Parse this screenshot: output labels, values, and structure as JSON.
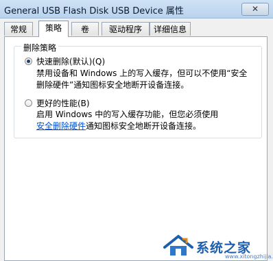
{
  "window": {
    "title": "General USB Flash Disk USB Device 属性",
    "close_glyph": "✕"
  },
  "tabs": [
    {
      "label": "常规"
    },
    {
      "label": "策略"
    },
    {
      "label": "卷"
    },
    {
      "label": "驱动程序"
    },
    {
      "label": "详细信息"
    }
  ],
  "active_tab": "策略",
  "removal_policy": {
    "group_title": "删除策略",
    "options": [
      {
        "label": "快速删除(默认)(Q)",
        "selected": true,
        "description_lines": [
          "禁用设备和 Windows 上的写入缓存，但可以不使用“安全",
          "删除硬件”通知图标安全地断开设备连接。"
        ]
      },
      {
        "label": "更好的性能(B)",
        "selected": false,
        "description_line1": "启用 Windows 中的写入缓存功能，但您必须使用",
        "link_text": "安全删除硬件",
        "description_line2_rest": "通知图标安全地断开设备连接。"
      }
    ]
  },
  "watermark": {
    "text": "系统之家",
    "url": "www.xitongzhijia.net"
  }
}
